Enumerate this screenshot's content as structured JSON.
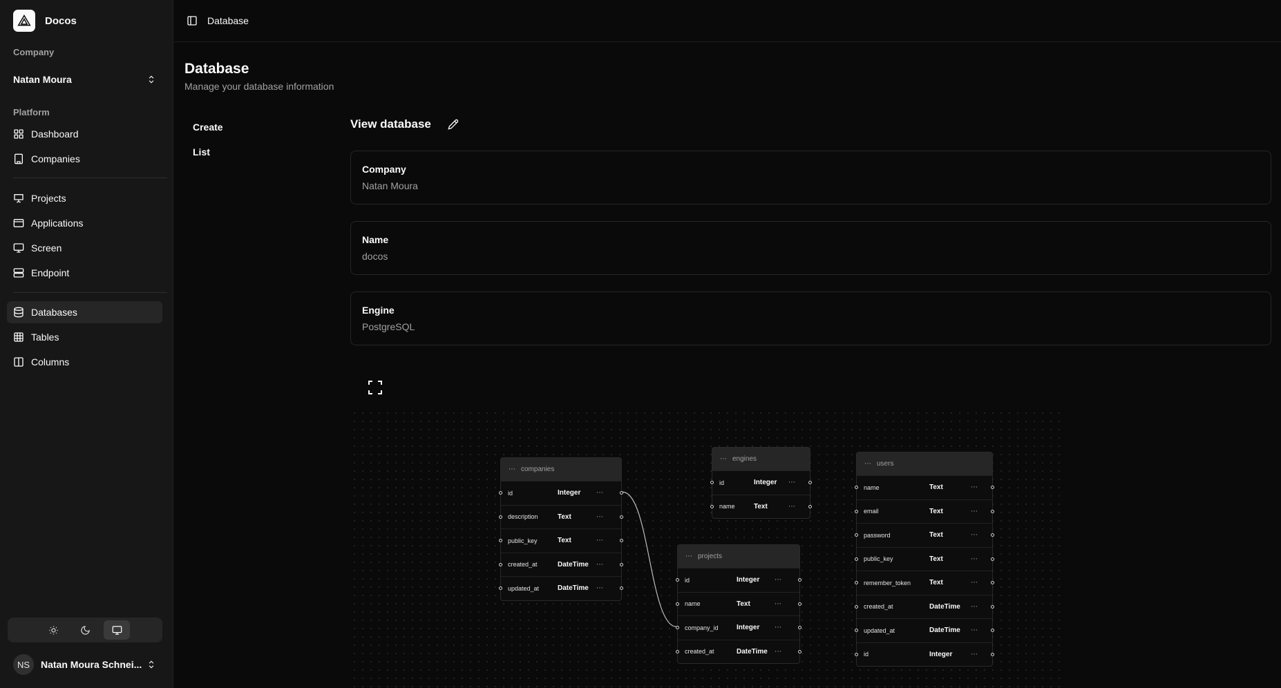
{
  "app": {
    "name": "Docos"
  },
  "sidebar": {
    "company_label": "Company",
    "company_value": "Natan Moura",
    "platform_label": "Platform",
    "items": [
      {
        "id": "dashboard",
        "label": "Dashboard",
        "icon": "layout-grid-icon"
      },
      {
        "id": "companies",
        "label": "Companies",
        "icon": "building-icon"
      },
      {
        "id": "projects",
        "label": "Projects",
        "icon": "presentation-icon"
      },
      {
        "id": "applications",
        "label": "Applications",
        "icon": "app-window-icon"
      },
      {
        "id": "screen",
        "label": "Screen",
        "icon": "monitor-icon"
      },
      {
        "id": "endpoint",
        "label": "Endpoint",
        "icon": "server-icon"
      },
      {
        "id": "databases",
        "label": "Databases",
        "icon": "database-icon",
        "active": true
      },
      {
        "id": "tables",
        "label": "Tables",
        "icon": "table-icon"
      },
      {
        "id": "columns",
        "label": "Columns",
        "icon": "columns-icon"
      }
    ],
    "theme": {
      "options": [
        "light",
        "dark",
        "system"
      ],
      "selected": "system"
    },
    "user": {
      "initials": "NS",
      "name": "Natan Moura Schnei..."
    }
  },
  "header": {
    "breadcrumb": "Database"
  },
  "page": {
    "title": "Database",
    "subtitle": "Manage your database information",
    "subnav": [
      "Create",
      "List"
    ],
    "view_title": "View database",
    "fields": [
      {
        "label": "Company",
        "value": "Natan Moura"
      },
      {
        "label": "Name",
        "value": "docos"
      },
      {
        "label": "Engine",
        "value": "PostgreSQL"
      }
    ]
  },
  "diagram": {
    "tables": [
      {
        "id": "companies",
        "name": "companies",
        "columns": [
          {
            "name": "id",
            "type": "Integer"
          },
          {
            "name": "description",
            "type": "Text"
          },
          {
            "name": "public_key",
            "type": "Text"
          },
          {
            "name": "created_at",
            "type": "DateTime"
          },
          {
            "name": "updated_at",
            "type": "DateTime"
          }
        ]
      },
      {
        "id": "engines",
        "name": "engines",
        "columns": [
          {
            "name": "id",
            "type": "Integer"
          },
          {
            "name": "name",
            "type": "Text"
          }
        ]
      },
      {
        "id": "projects",
        "name": "projects",
        "columns": [
          {
            "name": "id",
            "type": "Integer"
          },
          {
            "name": "name",
            "type": "Text"
          },
          {
            "name": "company_id",
            "type": "Integer"
          },
          {
            "name": "created_at",
            "type": "DateTime"
          }
        ]
      },
      {
        "id": "users",
        "name": "users",
        "columns": [
          {
            "name": "name",
            "type": "Text"
          },
          {
            "name": "email",
            "type": "Text"
          },
          {
            "name": "password",
            "type": "Text"
          },
          {
            "name": "public_key",
            "type": "Text"
          },
          {
            "name": "remember_token",
            "type": "Text"
          },
          {
            "name": "created_at",
            "type": "DateTime"
          },
          {
            "name": "updated_at",
            "type": "DateTime"
          },
          {
            "name": "id",
            "type": "Integer"
          }
        ]
      }
    ],
    "relations": [
      {
        "from_table": "companies",
        "from_column": "id",
        "to_table": "projects",
        "to_column": "company_id"
      }
    ]
  }
}
